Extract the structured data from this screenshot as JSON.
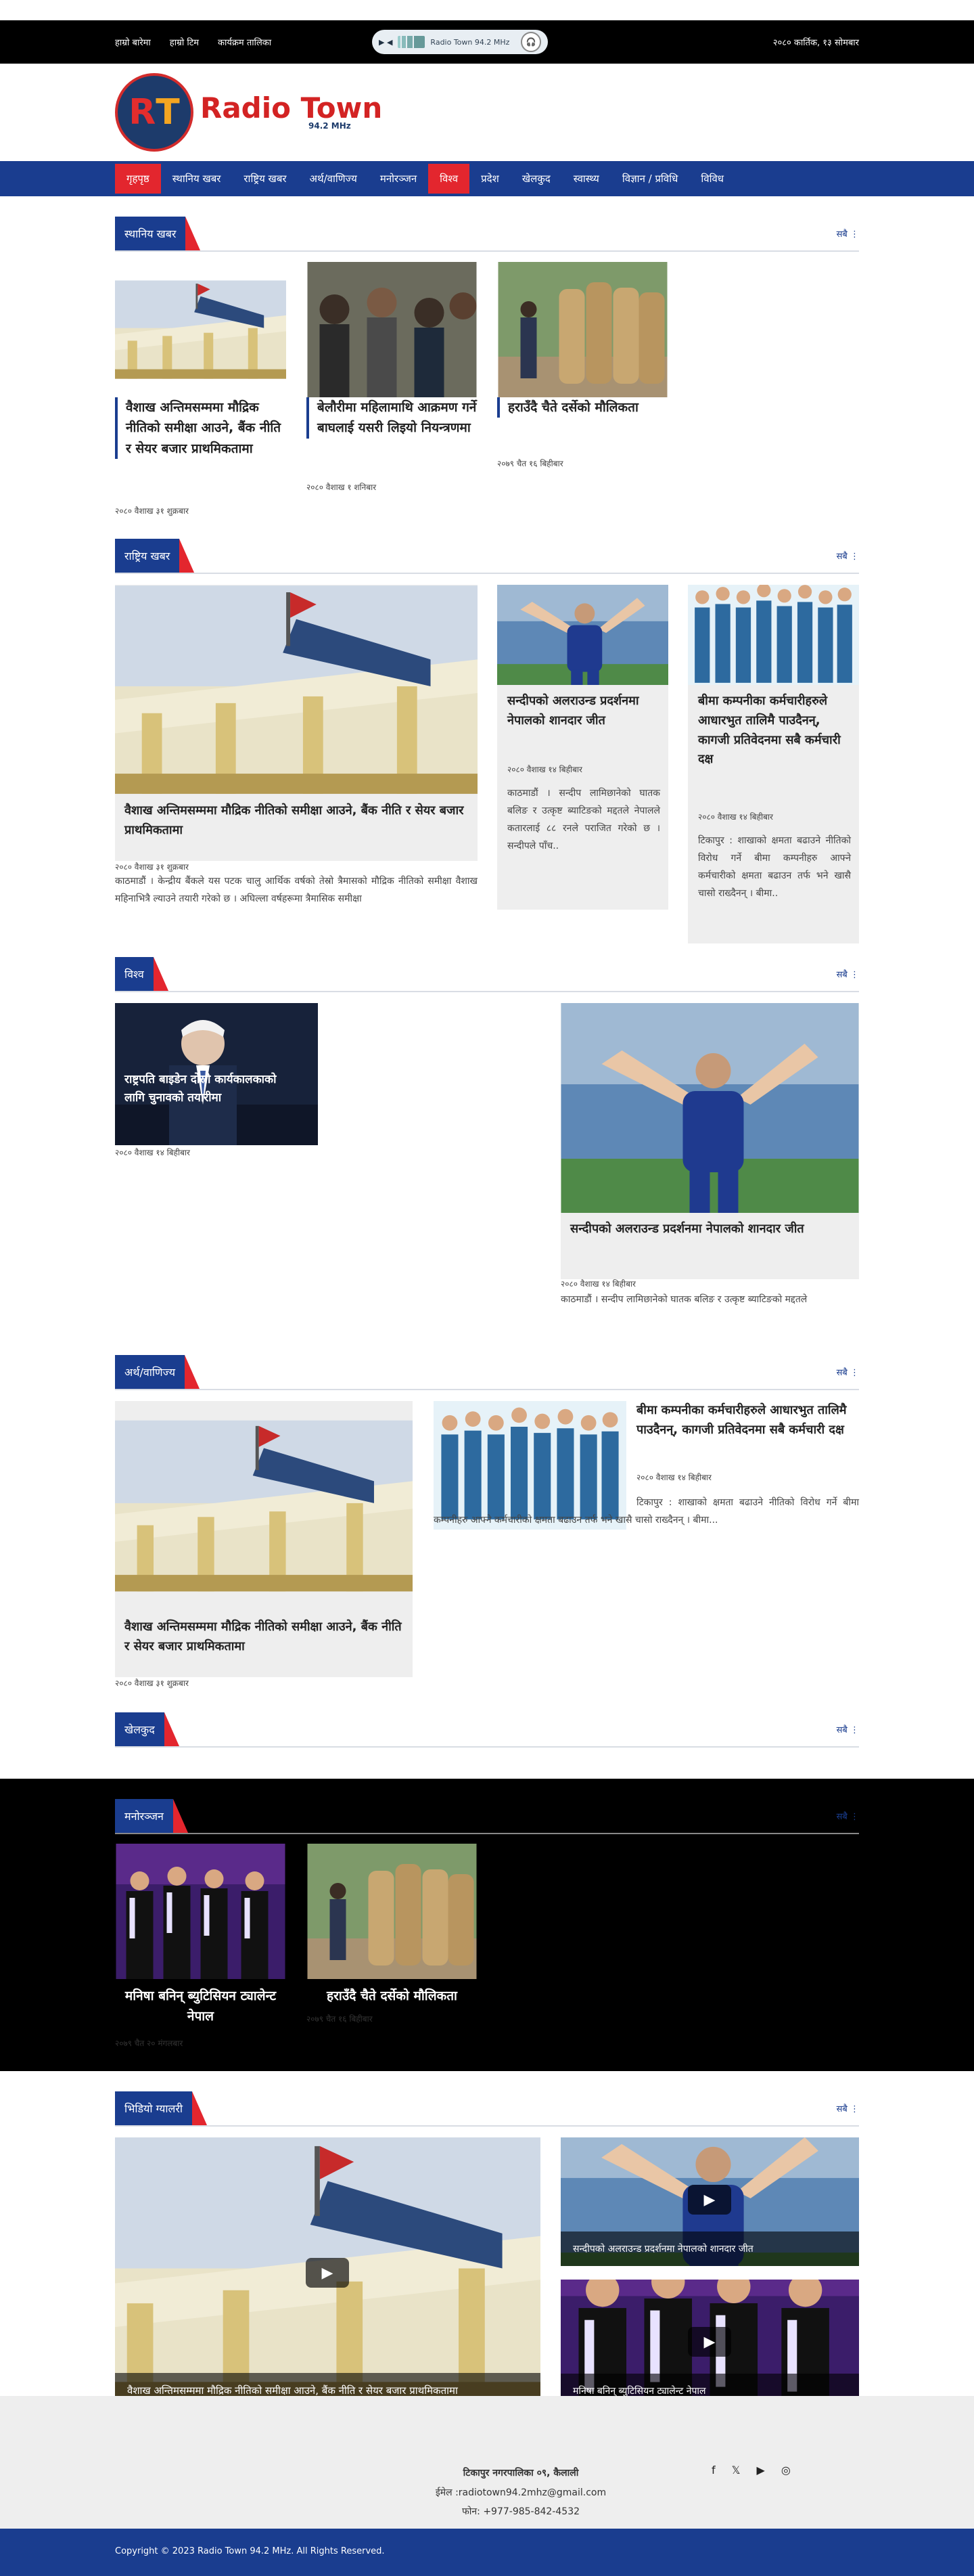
{
  "topbar": {
    "links": [
      "हाम्रो बारेमा",
      "हाम्रो टिम",
      "कार्यक्रम तालिका"
    ],
    "player_title": "Radio Town 94.2 MHz",
    "date": "२०८० कार्तिक, १३ सोमबार"
  },
  "logo": {
    "name": "Radio Town",
    "freq": "94.2 MHz"
  },
  "nav": [
    "गृहपृष्ठ",
    "स्थानिय खबर",
    "राष्ट्रिय खबर",
    "अर्थ/वाणिज्य",
    "मनोरञ्जन",
    "विश्व",
    "प्रदेश",
    "खेलकुद",
    "स्वास्थ्य",
    "विज्ञान / प्रविधि",
    "विविध"
  ],
  "more_label": "सबै",
  "local": {
    "title": "स्थानिय खबर",
    "items": [
      {
        "title": "वैशाख अन्तिमसम्ममा मौद्रिक नीतिको समीक्षा आउने, बैंक नीति र सेयर बजार प्राथमिकतामा",
        "date": "२०८० वैशाख ३१ शुक्रबार"
      },
      {
        "title": "बेलौरीमा महिलामाथि आक्रमण गर्ने बाघलाई यसरी लिइयो नियन्त्रणमा",
        "date": "२०८० वैशाख १ शनिबार"
      },
      {
        "title": "हराउँदै चैते दर्सेको मौलिकता",
        "date": "२०७९ चैत १६ बिहीबार"
      }
    ]
  },
  "national": {
    "title": "राष्ट्रिय खबर",
    "main": {
      "title": "वैशाख अन्तिमसम्ममा मौद्रिक नीतिको समीक्षा आउने, बैंक नीति र सेयर बजार प्राथमिकतामा",
      "date": "२०८० वैशाख ३१ शुक्रबार",
      "desc": "काठमाडौं । केन्द्रीय बैंकले यस पटक चालु आर्थिक वर्षको तेस्रो त्रैमासको मौद्रिक नीतिको समीक्षा वैशाख महिनाभित्रै ल्याउने तयारी गरेको छ । अघिल्ला वर्षहरूमा त्रैमासिक समीक्षा"
    },
    "side1": {
      "title": "सन्दीपको अलराउन्ड प्रदर्शनमा नेपालको शानदार जीत",
      "date": "२०८० वैशाख १४ बिहीबार",
      "desc": "काठमाडौं । सन्दीप लामिछानेको घातक बलिङ र उत्कृष्ट ब्याटिङको मद्दतले नेपालले कतारलाई ८८ रनले पराजित गरेको छ । सन्दीपले पाँच.."
    },
    "side2": {
      "title": "बीमा कम्पनीका कर्मचारीहरुले आधारभुत तालिमै पाउदैनन्, कागजी प्रतिवेदनमा सबै कर्मचारी दक्ष",
      "date": "२०८० वैशाख १४ बिहीबार",
      "desc": "टिकापुर : शाखाको क्षमता बढाउने नीतिको विरोध गर्ने बीमा कम्पनीहरु आफ्ने कर्मचारीको क्षमता बढाउन तर्फ भने खासै चासो राख्दैनन् । बीमा.."
    }
  },
  "world": {
    "title": "विश्व",
    "small": {
      "title": "राष्ट्रपति बाइडेन दोस्रो कार्यकालकाको लागि चुनावको तयारीमा",
      "date": "२०८० वैशाख १४ बिहीबार"
    },
    "big": {
      "title": "सन्दीपको अलराउन्ड प्रदर्शनमा नेपालको शानदार जीत",
      "date": "२०८० वैशाख १४ बिहीबार",
      "desc": "काठमाडौं । सन्दीप लामिछानेको घातक बलिङ र उत्कृष्ट ब्याटिङको मद्दतले"
    }
  },
  "economy": {
    "title": "अर्थ/वाणिज्य",
    "main": {
      "title": "वैशाख अन्तिमसम्ममा मौद्रिक नीतिको समीक्षा आउने, बैंक नीति र सेयर बजार प्राथमिकतामा",
      "date": "२०८० वैशाख ३१ शुक्रबार"
    },
    "side": {
      "title": "बीमा कम्पनीका कर्मचारीहरुले आधारभुत तालिमै पाउदैनन्, कागजी प्रतिवेदनमा सबै कर्मचारी दक्ष",
      "date": "२०८० वैशाख १४ बिहीबार",
      "desc": "टिकापुर : शाखाको क्षमता बढाउने नीतिको विरोध गर्ने बीमा कम्पनीहरु आफ्ने कर्मचारीको क्षमता बढाउन तर्फ भने खासै चासो राख्दैनन् । बीमा..."
    }
  },
  "sports": {
    "title": "खेलकुद"
  },
  "entertainment": {
    "title": "मनोरञ्जन",
    "items": [
      {
        "title": "मनिषा बनिन् ब्युटिसियन ट्यालेन्ट नेपाल",
        "date": "२०७९ चैत २० मंगलबार"
      },
      {
        "title": "हराउँदै चैते दर्सेको मौलिकता",
        "date": "२०७९ चैत १६ बिहीबार"
      }
    ]
  },
  "video": {
    "title": "भिडियो ग्यालरी",
    "main": "वैशाख अन्तिमसम्ममा मौद्रिक नीतिको समीक्षा आउने, बैंक नीति र सेयर बजार प्राथमिकतामा",
    "side1": "सन्दीपको अलराउन्ड प्रदर्शनमा नेपालको शानदार जीत",
    "side2": "मनिषा बनिन् ब्युटिसियन ट्यालेन्ट नेपाल"
  },
  "footer": {
    "address": "टिकापुर नगरपालिका ०९, कैलाली",
    "email": "ईमेल :radiotown94.2mhz@gmail.com",
    "phone": "फोन: +977-985-842-4532",
    "copyright": "Copyright © 2023 Radio Town 94.2 MHz. All Rights Reserved."
  },
  "colors": {
    "brand_blue": "#1a3d8f",
    "accent_red": "#e3262e"
  },
  "icons": [
    "play-icon",
    "headphones-icon",
    "facebook-icon",
    "twitter-icon",
    "youtube-icon",
    "instagram-icon",
    "more-dots-icon"
  ]
}
